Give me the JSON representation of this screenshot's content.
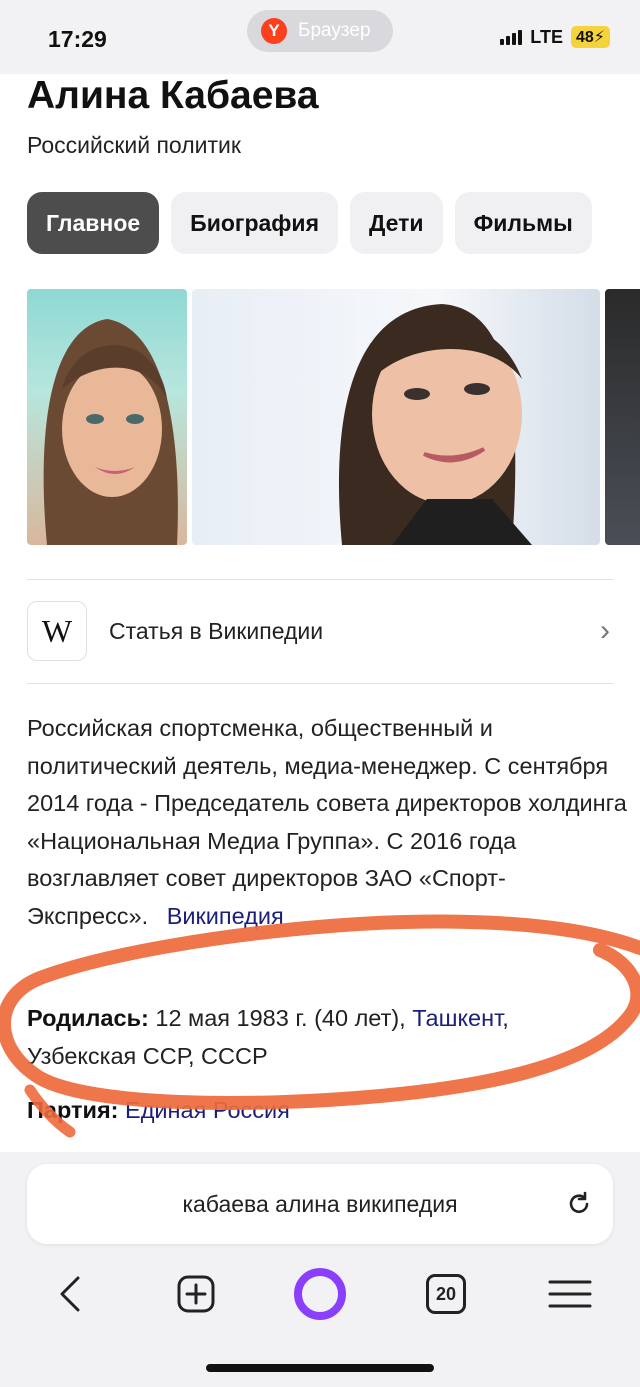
{
  "status_bar": {
    "time": "17:29",
    "browser_badge": "Браузер",
    "network": "LTE",
    "battery": "48"
  },
  "header": {
    "title": "Алина Кабаева",
    "subtitle": "Российский политик"
  },
  "tabs": [
    {
      "label": "Главное",
      "active": true
    },
    {
      "label": "Биография",
      "active": false
    },
    {
      "label": "Дети",
      "active": false
    },
    {
      "label": "Фильмы",
      "active": false
    }
  ],
  "wiki_card": {
    "logo": "W",
    "label": "Статья в Википедии"
  },
  "description": {
    "text": "Российская спортсменка, общественный и политический деятель, медиа-менеджер. С сентября 2014 года - Председатель совета директоров холдинга «Национальная Медиа Группа». С 2016 года возглавляет совет директоров ЗАО «Спорт-Экспресс».",
    "source_link": "Википедия"
  },
  "facts": {
    "born_label": "Родилась:",
    "born_value": "12 мая 1983 г. (40 лет),",
    "born_place_link": "Ташкент",
    "born_place_rest": ", Узбекская ССР, СССР",
    "party_label": "Партия:",
    "party_link": "Единая Россия"
  },
  "address_bar": {
    "query": "кабаева алина википедия"
  },
  "toolbar": {
    "tab_count": "20"
  },
  "colors": {
    "annotation_stroke": "#ee6a3c",
    "link": "#1b1f7a",
    "active_tab": "#4d4d4d",
    "alice_accent": "#8a3ffc"
  }
}
